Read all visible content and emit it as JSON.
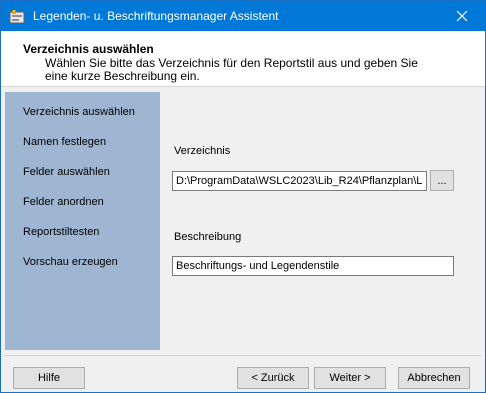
{
  "window": {
    "title": "Legenden- u. Beschriftungsmanager Assistent",
    "icons": {
      "app": "wizard-app-icon",
      "close": "close-icon"
    }
  },
  "header": {
    "title": "Verzeichnis auswählen",
    "description": "Wählen Sie bitte das Verzeichnis für den Reportstil aus und geben Sie eine kurze Beschreibung ein."
  },
  "sidebar": {
    "items": [
      {
        "label": "Verzeichnis auswählen"
      },
      {
        "label": "Namen festlegen"
      },
      {
        "label": "Felder auswählen"
      },
      {
        "label": "Felder anordnen"
      },
      {
        "label": "Reportstiltesten"
      },
      {
        "label": "Vorschau erzeugen"
      }
    ],
    "background": "#9fb6d3"
  },
  "form": {
    "directory": {
      "label": "Verzeichnis",
      "value": "D:\\ProgramData\\WSLC2023\\Lib_R24\\Pflanzplan\\L",
      "browse_label": "..."
    },
    "description": {
      "label": "Beschreibung",
      "value": "Beschriftungs- und Legendenstile"
    }
  },
  "buttons": {
    "help": "Hilfe",
    "back": "< Zurück",
    "next": "Weiter >",
    "cancel": "Abbrechen"
  },
  "colors": {
    "titlebar": "#0078d7",
    "sidebar": "#9fb6d3",
    "dialog_bg": "#f0f0f0"
  }
}
